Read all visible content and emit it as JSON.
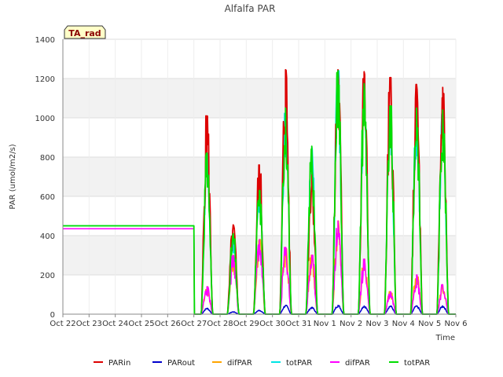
{
  "chart_data": {
    "type": "line",
    "title": "Alfalfa PAR",
    "xlabel": "Time",
    "ylabel": "PAR (umol/m2/s)",
    "ylim": [
      0,
      1400
    ],
    "yticks": [
      0,
      200,
      400,
      600,
      800,
      1000,
      1200,
      1400
    ],
    "x_tick_labels": [
      "Oct 22",
      "Oct 23",
      "Oct 24",
      "Oct 25",
      "Oct 26",
      "Oct 27",
      "Oct 28",
      "Oct 29",
      "Oct 30",
      "Oct 31",
      "Nov 1",
      "Nov 2",
      "Nov 3",
      "Nov 4",
      "Nov 5",
      "Nov 6"
    ],
    "x_range_days": [
      0,
      15
    ],
    "grid": true,
    "legend_position": "bottom",
    "annotation": "TA_rad",
    "colors": {
      "PARin": "#dd0000",
      "PARout": "#0000cc",
      "difPAR_1": "#ffa500",
      "totPAR_1": "#00e5e5",
      "difPAR_2": "#ff00ff",
      "totPAR_2": "#00dd00",
      "band": "#f2f2f2",
      "grid": "#dddddd"
    },
    "daily_peaks": [
      {
        "day": "Oct 27",
        "PARin": 1010,
        "PARout": 30,
        "difPAR": 140,
        "totPAR": 820
      },
      {
        "day": "Oct 28",
        "PARin": 455,
        "PARout": 12,
        "difPAR": 300,
        "totPAR": 410
      },
      {
        "day": "Oct 29",
        "PARin": 760,
        "PARout": 20,
        "difPAR": 380,
        "totPAR": 630
      },
      {
        "day": "Oct 30",
        "PARin": 1245,
        "PARout": 45,
        "difPAR": 340,
        "totPAR": 1050
      },
      {
        "day": "Oct 31",
        "PARin": 750,
        "PARout": 35,
        "difPAR": 300,
        "totPAR": 855
      },
      {
        "day": "Nov 1",
        "PARin": 1245,
        "PARout": 45,
        "difPAR": 475,
        "totPAR": 1240
      },
      {
        "day": "Nov 2",
        "PARin": 1235,
        "PARout": 42,
        "difPAR": 280,
        "totPAR": 1175
      },
      {
        "day": "Nov 3",
        "PARin": 1205,
        "PARout": 42,
        "difPAR": 115,
        "totPAR": 1060
      },
      {
        "day": "Nov 4",
        "PARin": 1170,
        "PARout": 42,
        "difPAR": 200,
        "totPAR": 1050
      },
      {
        "day": "Nov 5",
        "PARin": 1155,
        "PARout": 42,
        "difPAR": 150,
        "totPAR": 1040
      }
    ],
    "flat_segment": {
      "from": "Oct 22",
      "to": "Oct 27",
      "difPAR": 435,
      "totPAR": 450
    },
    "series": [
      {
        "name": "PARin",
        "color": "#dd0000"
      },
      {
        "name": "PARout",
        "color": "#0000cc"
      },
      {
        "name": "difPAR",
        "color": "#ffa500"
      },
      {
        "name": "totPAR",
        "color": "#00e5e5"
      },
      {
        "name": "difPAR",
        "color": "#ff00ff"
      },
      {
        "name": "totPAR",
        "color": "#00dd00"
      }
    ]
  }
}
